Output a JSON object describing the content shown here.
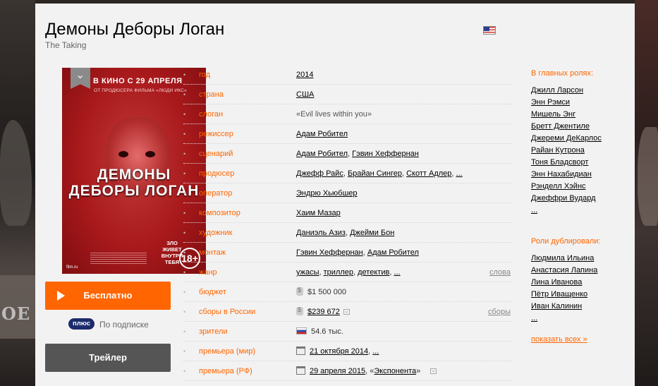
{
  "movie": {
    "title": "Демоны Деборы Логан",
    "original_title": "The Taking",
    "country_flag_icon": "us-flag-icon"
  },
  "poster": {
    "top_text": "В КИНО С 29 АПРЕЛЯ",
    "sub_text": "ОТ ПРОДЮСЕРА ФИЛЬМА «ЛЮДИ ИКС»",
    "title": "ДЕМОНЫ ДЕБОРЫ ЛОГАН",
    "tagline": "ЗЛО ЖИВЕТ ВНУТРИ ТЕБЯ",
    "age": "18+",
    "site": "film.ru"
  },
  "actions": {
    "free_label": "Бесплатно",
    "plus_badge": "плюс",
    "plus_text": "По подписке",
    "trailer_label": "Трейлер"
  },
  "info": {
    "year": {
      "label": "год",
      "value": "2014"
    },
    "country": {
      "label": "страна",
      "value": "США"
    },
    "slogan": {
      "label": "слоган",
      "value": "«Evil lives within you»"
    },
    "director": {
      "label": "режиссер",
      "values": [
        "Адам Робител"
      ]
    },
    "writer": {
      "label": "сценарий",
      "values": [
        "Адам Робител",
        "Гэвин Хеффернан"
      ]
    },
    "producer": {
      "label": "продюсер",
      "values": [
        "Джефф Райс",
        "Брайан Сингер",
        "Скотт Адлер",
        "..."
      ]
    },
    "operator": {
      "label": "оператор",
      "values": [
        "Эндрю Хьюбшер"
      ]
    },
    "composer": {
      "label": "композитор",
      "values": [
        "Хаим Мазар"
      ]
    },
    "artist": {
      "label": "художник",
      "values": [
        "Даниэль Азиз",
        "Джейми Бон"
      ]
    },
    "editing": {
      "label": "монтаж",
      "values": [
        "Гэвин Хеффернан",
        "Адам Робител"
      ]
    },
    "genre": {
      "label": "жанр",
      "values": [
        "ужасы",
        "триллер",
        "детектив",
        "..."
      ],
      "right_link": "слова"
    },
    "budget": {
      "label": "бюджет",
      "value": "$1 500 000"
    },
    "box_office_ru": {
      "label": "сборы в России",
      "value": "$239 672",
      "right_link": "сборы"
    },
    "viewers": {
      "label": "зрители",
      "value": "54.6 тыс."
    },
    "premiere_world": {
      "label": "премьера (мир)",
      "date": "21 октября 2014",
      "more": "..."
    },
    "premiere_ru": {
      "label": "премьера (РФ)",
      "date": "29 апреля 2015",
      "prefix": "«",
      "distributor": "Экспонента",
      "suffix": "»"
    }
  },
  "cast": {
    "main_heading": "В главных ролях:",
    "main": [
      "Джилл Ларсон",
      "Энн Рэмси",
      "Мишель Энг",
      "Бретт Джентиле",
      "Джереми ДеКарлос",
      "Райан Кутрона",
      "Тоня Бладсворт",
      "Энн Нахабидиан",
      "Рэнделл Хэйнс",
      "Джеффри Вудард",
      "..."
    ],
    "dubbing_heading": "Роли дублировали:",
    "dubbing": [
      "Людмила Ильина",
      "Анастасия Лапина",
      "Лина Иванова",
      "Пётр Иващенко",
      "Иван Калинин",
      "..."
    ],
    "show_all": "показать всех",
    "show_all_arrow": "»"
  }
}
